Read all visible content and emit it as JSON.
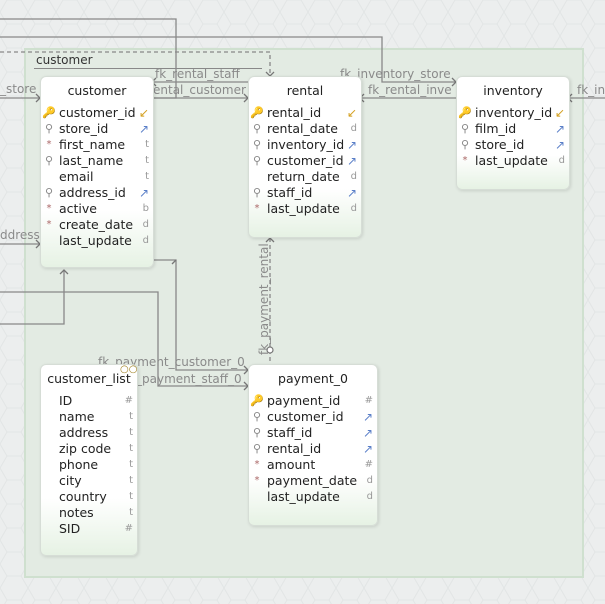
{
  "group": {
    "label": "customer"
  },
  "tables": [
    {
      "id": "customer",
      "title": "customer",
      "columns": [
        {
          "name": "customer_id",
          "icon": "pk",
          "type_glyph": "pk-arrow"
        },
        {
          "name": "store_id",
          "icon": "fk",
          "type_glyph": "fk-arrow"
        },
        {
          "name": "first_name",
          "icon": "req",
          "type_glyph": "t"
        },
        {
          "name": "last_name",
          "icon": "fk",
          "type_glyph": "t"
        },
        {
          "name": "email",
          "icon": "none",
          "type_glyph": "t"
        },
        {
          "name": "address_id",
          "icon": "fk",
          "type_glyph": "fk-arrow"
        },
        {
          "name": "active",
          "icon": "req",
          "type_glyph": "b"
        },
        {
          "name": "create_date",
          "icon": "req",
          "type_glyph": "d"
        },
        {
          "name": "last_update",
          "icon": "none",
          "type_glyph": "d"
        }
      ]
    },
    {
      "id": "rental",
      "title": "rental",
      "columns": [
        {
          "name": "rental_id",
          "icon": "pk",
          "type_glyph": "pk-arrow"
        },
        {
          "name": "rental_date",
          "icon": "fk",
          "type_glyph": "d"
        },
        {
          "name": "inventory_id",
          "icon": "fk",
          "type_glyph": "fk-arrow"
        },
        {
          "name": "customer_id",
          "icon": "fk",
          "type_glyph": "fk-arrow"
        },
        {
          "name": "return_date",
          "icon": "none",
          "type_glyph": "d"
        },
        {
          "name": "staff_id",
          "icon": "fk",
          "type_glyph": "fk-arrow"
        },
        {
          "name": "last_update",
          "icon": "req",
          "type_glyph": "d"
        }
      ]
    },
    {
      "id": "inventory",
      "title": "inventory",
      "columns": [
        {
          "name": "inventory_id",
          "icon": "pk",
          "type_glyph": "pk-arrow"
        },
        {
          "name": "film_id",
          "icon": "fk",
          "type_glyph": "fk-arrow"
        },
        {
          "name": "store_id",
          "icon": "fk",
          "type_glyph": "fk-arrow"
        },
        {
          "name": "last_update",
          "icon": "req",
          "type_glyph": "d"
        }
      ]
    },
    {
      "id": "customer_list",
      "title": "customer_list",
      "columns": [
        {
          "name": "ID",
          "icon": "none",
          "type_glyph": "#"
        },
        {
          "name": "name",
          "icon": "none",
          "type_glyph": "t"
        },
        {
          "name": "address",
          "icon": "none",
          "type_glyph": "t"
        },
        {
          "name": "zip code",
          "icon": "none",
          "type_glyph": "t"
        },
        {
          "name": "phone",
          "icon": "none",
          "type_glyph": "t"
        },
        {
          "name": "city",
          "icon": "none",
          "type_glyph": "t"
        },
        {
          "name": "country",
          "icon": "none",
          "type_glyph": "t"
        },
        {
          "name": "notes",
          "icon": "none",
          "type_glyph": "t"
        },
        {
          "name": "SID",
          "icon": "none",
          "type_glyph": "#"
        }
      ]
    },
    {
      "id": "payment_0",
      "title": "payment_0",
      "columns": [
        {
          "name": "payment_id",
          "icon": "pk",
          "type_glyph": "#"
        },
        {
          "name": "customer_id",
          "icon": "fk",
          "type_glyph": "fk-arrow"
        },
        {
          "name": "staff_id",
          "icon": "fk",
          "type_glyph": "fk-arrow"
        },
        {
          "name": "rental_id",
          "icon": "fk",
          "type_glyph": "fk-arrow"
        },
        {
          "name": "amount",
          "icon": "req",
          "type_glyph": "#"
        },
        {
          "name": "payment_date",
          "icon": "req",
          "type_glyph": "d"
        },
        {
          "name": "last_update",
          "icon": "none",
          "type_glyph": "d"
        }
      ]
    }
  ],
  "relations": [
    {
      "id": "r1",
      "label": "_store"
    },
    {
      "id": "r2",
      "label": "fk_rental_staff"
    },
    {
      "id": "r3",
      "label": "ental_customer"
    },
    {
      "id": "r4",
      "label": "fk_inventory_store"
    },
    {
      "id": "r5",
      "label": "fk_rental_inve"
    },
    {
      "id": "r6",
      "label": "fk_in"
    },
    {
      "id": "r7",
      "label": "ddress"
    },
    {
      "id": "r8",
      "label": "fk_payment_rental"
    },
    {
      "id": "r9",
      "label": "fk_payment_customer_0"
    },
    {
      "id": "r10",
      "label": "_payment_staff_0"
    }
  ]
}
